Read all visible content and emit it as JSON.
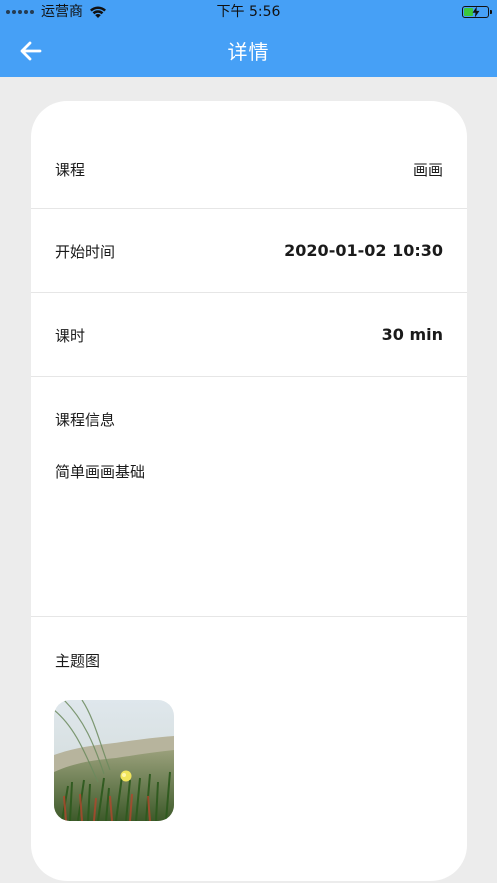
{
  "status_bar": {
    "carrier": "运营商",
    "time": "下午 5:56",
    "battery_level": 0.4,
    "signal_icon": "signal-dots-icon",
    "wifi_icon": "wifi-icon",
    "battery_icon": "charging-battery-icon"
  },
  "nav": {
    "title": "详情",
    "back_icon": "arrow-left-icon",
    "background_color": "#46a0f6"
  },
  "details": {
    "course_label": "课程",
    "course_value": "画画",
    "start_time_label": "开始时间",
    "start_time_value": "2020-01-02 10:30",
    "duration_label": "课时",
    "duration_value": "30 min",
    "info_label": "课程信息",
    "info_value": "简单画画基础",
    "theme_image_label": "主题图",
    "theme_image_icon": "grass-flower-photo"
  }
}
